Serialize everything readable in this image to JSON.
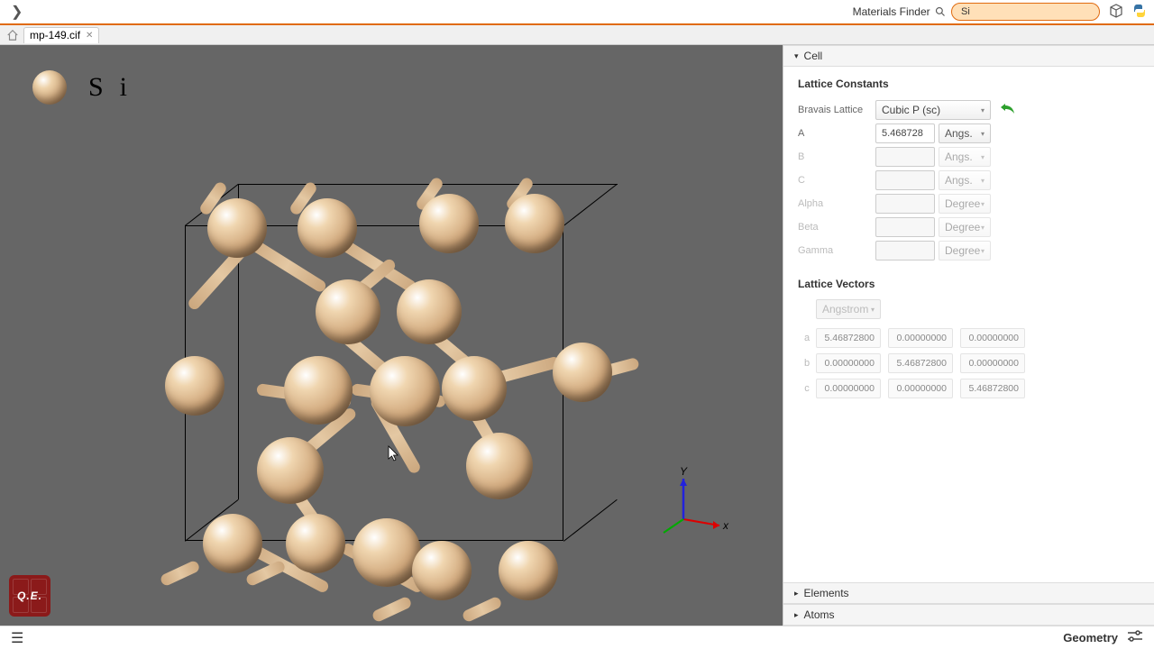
{
  "topbar": {
    "materials_finder_label": "Materials Finder",
    "search_value": "Si"
  },
  "tabs": {
    "filename": "mp-149.cif"
  },
  "legend": {
    "element": "Si"
  },
  "axis": {
    "x": "x",
    "y": "Y"
  },
  "qe": {
    "label": "Q.E."
  },
  "panel": {
    "section_cell": "Cell",
    "lattice_constants_hdr": "Lattice Constants",
    "bravais_label": "Bravais Lattice",
    "bravais_value": "Cubic P (sc)",
    "a_label": "A",
    "a_value": "5.468728",
    "a_unit": "Angs.",
    "b_label": "B",
    "b_unit": "Angs.",
    "c_label": "C",
    "c_unit": "Angs.",
    "alpha_label": "Alpha",
    "alpha_unit": "Degree",
    "beta_label": "Beta",
    "beta_unit": "Degree",
    "gamma_label": "Gamma",
    "gamma_unit": "Degree",
    "lattice_vectors_hdr": "Lattice Vectors",
    "vec_unit": "Angstrom",
    "va_label": "a",
    "va": [
      "5.46872800",
      "0.00000000",
      "0.00000000"
    ],
    "vb_label": "b",
    "vb": [
      "0.00000000",
      "5.46872800",
      "0.00000000"
    ],
    "vc_label": "c",
    "vc": [
      "0.00000000",
      "0.00000000",
      "5.46872800"
    ],
    "section_elements": "Elements",
    "section_atoms": "Atoms"
  },
  "bottombar": {
    "geometry": "Geometry"
  }
}
